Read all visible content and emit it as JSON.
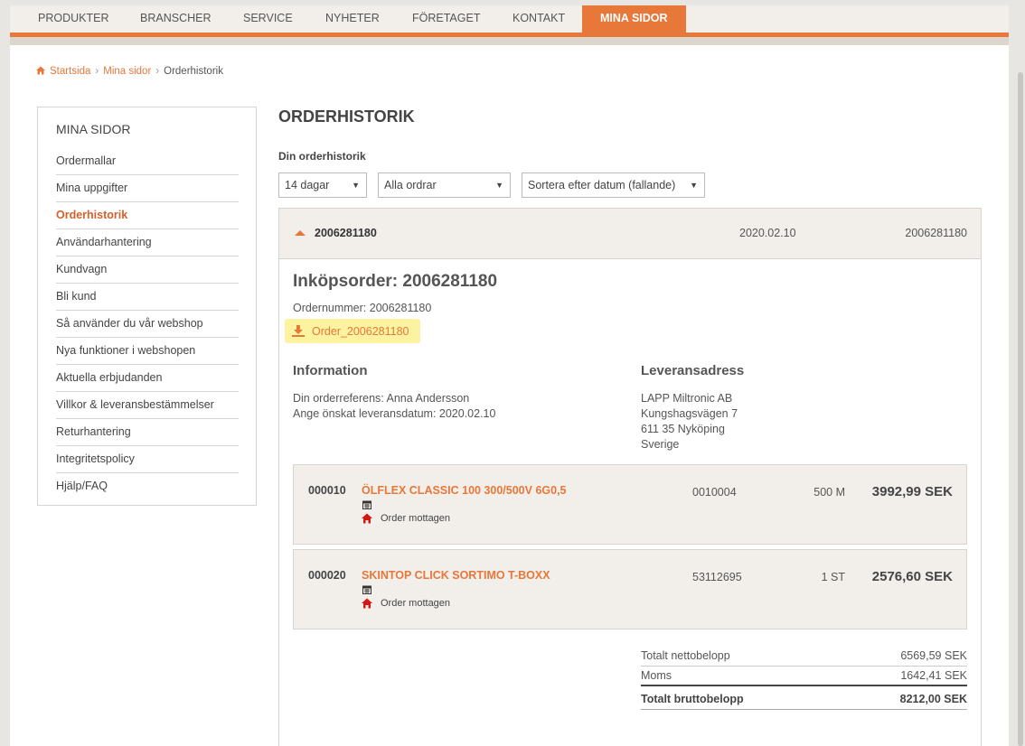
{
  "nav": {
    "items": [
      "PRODUKTER",
      "BRANSCHER",
      "SERVICE",
      "NYHETER",
      "FÖRETAGET",
      "KONTAKT"
    ],
    "active": "MINA SIDOR",
    "accent_color": "#e8773a"
  },
  "breadcrumb": {
    "home": "Startsida",
    "mina_sidor": "Mina sidor",
    "current": "Orderhistorik"
  },
  "sidebar": {
    "title": "MINA SIDOR",
    "items": [
      "Ordermallar",
      "Mina uppgifter",
      "Orderhistorik",
      "Användarhantering",
      "Kundvagn",
      "Bli kund",
      "Så använder du vår webshop",
      "Nya funktioner i webshopen",
      "Aktuella erbjudanden",
      "Villkor & leveransbestämmelser",
      "Returhantering",
      "Integritetspolicy",
      "Hjälp/FAQ"
    ],
    "active_index": 2
  },
  "main": {
    "title": "ORDERHISTORIK",
    "subhead": "Din orderhistorik",
    "filters": {
      "period": "14 dagar",
      "type": "Alla ordrar",
      "sort": "Sortera efter datum (fallande)"
    }
  },
  "order": {
    "header_number": "2006281180",
    "header_date": "2020.02.10",
    "header_number_right": "2006281180",
    "title": "Inköpsorder: 2006281180",
    "order_number_line": "Ordernummer: 2006281180",
    "download_label": "Order_2006281180",
    "information": {
      "heading": "Information",
      "reference": "Din orderreferens: Anna Andersson",
      "delivery_date": "Ange önskat leveransdatum: 2020.02.10"
    },
    "address": {
      "heading": "Leveransadress",
      "lines": [
        "LAPP Miltronic AB",
        "Kungshagsvägen 7",
        "611 35 Nyköping",
        "Sverige"
      ]
    },
    "items": [
      {
        "pos": "000010",
        "name": "ÖLFLEX CLASSIC 100 300/500V 6G0,5",
        "status": "Order mottagen",
        "article": "0010004",
        "qty": "500 M",
        "price": "3992,99 SEK"
      },
      {
        "pos": "000020",
        "name": "SKINTOP CLICK SORTIMO T-BOXX",
        "status": "Order mottagen",
        "article": "53112695",
        "qty": "1 ST",
        "price": "2576,60 SEK"
      }
    ],
    "totals": {
      "net_label": "Totalt nettobelopp",
      "net_value": "6569,59 SEK",
      "vat_label": "Moms",
      "vat_value": "1642,41 SEK",
      "gross_label": "Totalt bruttobelopp",
      "gross_value": "8212,00 SEK"
    }
  }
}
